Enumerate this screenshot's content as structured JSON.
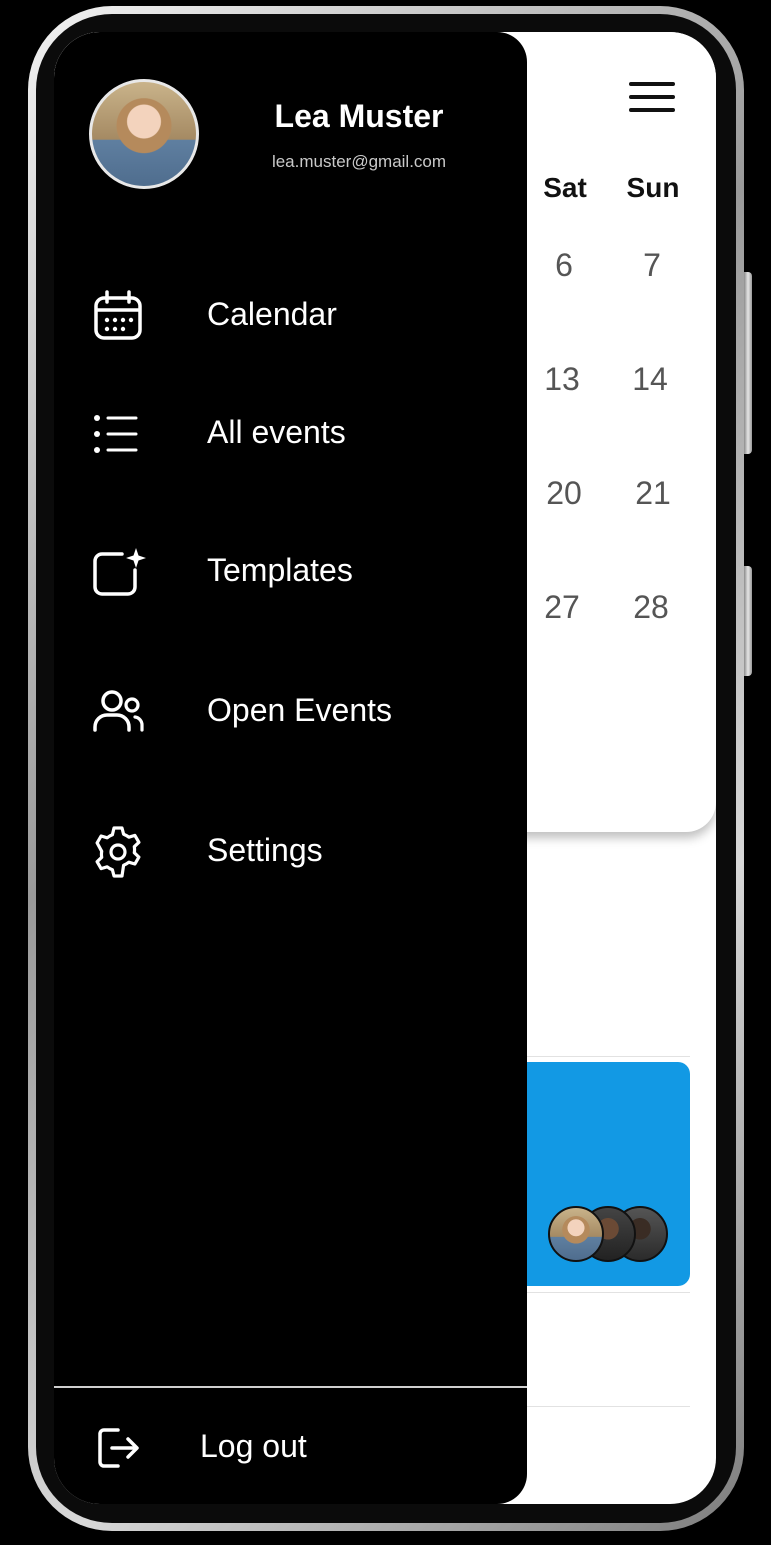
{
  "profile": {
    "name": "Lea Muster",
    "email": "lea.muster@gmail.com"
  },
  "menu": [
    {
      "label": "Calendar",
      "icon": "calendar-icon"
    },
    {
      "label": "All events",
      "icon": "list-icon"
    },
    {
      "label": "Templates",
      "icon": "template-sparkle-icon"
    },
    {
      "label": "Open Events",
      "icon": "users-icon"
    },
    {
      "label": "Settings",
      "icon": "gear-icon"
    }
  ],
  "logout": {
    "label": "Log out",
    "icon": "logout-icon"
  },
  "calendar": {
    "days": [
      "Sat",
      "Sun"
    ],
    "weeks": [
      [
        "6",
        "7"
      ],
      [
        "13",
        "14"
      ],
      [
        "20",
        "21"
      ],
      [
        "27",
        "28"
      ]
    ]
  },
  "colors": {
    "drawer_bg": "#000000",
    "event_card": "#1299e4",
    "text_light": "#ffffff"
  }
}
